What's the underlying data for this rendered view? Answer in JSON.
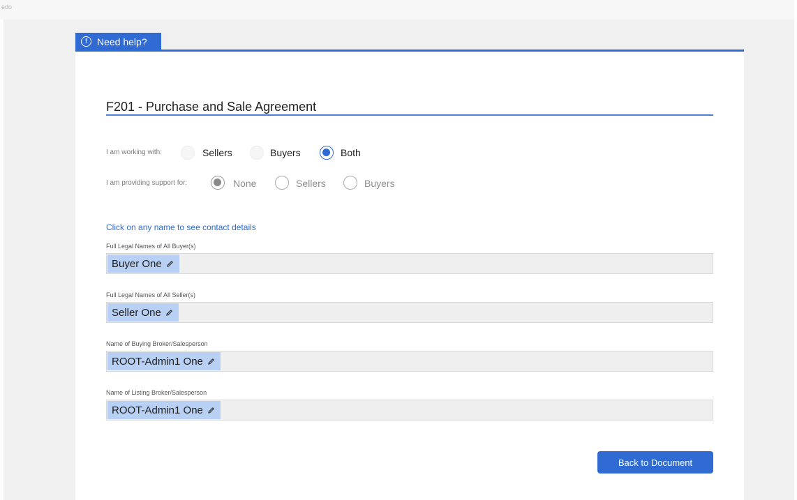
{
  "corner_text": "edo",
  "help": {
    "label": "Need help?"
  },
  "title": "F201 - Purchase and Sale Agreement",
  "working_with": {
    "label": "I am working with:",
    "options": [
      "Sellers",
      "Buyers",
      "Both"
    ],
    "selected": "Both"
  },
  "support_for": {
    "label": "I am providing support for:",
    "options": [
      "None",
      "Sellers",
      "Buyers"
    ],
    "selected": "None"
  },
  "instructions": "Click on any name to see contact details",
  "fields": [
    {
      "label": "Full Legal Names of All Buyer(s)",
      "value": "Buyer One"
    },
    {
      "label": "Full Legal Names of All Seller(s)",
      "value": "Seller One"
    },
    {
      "label": "Name of Buying Broker/Salesperson",
      "value": "ROOT-Admin1 One"
    },
    {
      "label": "Name of Listing Broker/Salesperson",
      "value": "ROOT-Admin1 One"
    }
  ],
  "back_button": "Back to Document",
  "colors": {
    "accent": "#2f6bd3",
    "chip": "#b8d0f3",
    "field_bg": "#efefef",
    "page_bg": "#f0f0f0"
  }
}
